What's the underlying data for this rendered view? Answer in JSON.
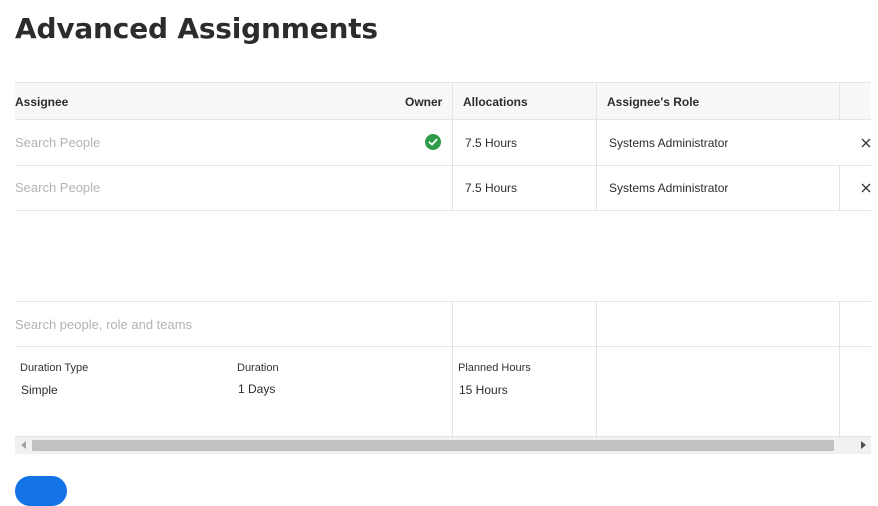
{
  "page": {
    "title": "Advanced Assignments"
  },
  "table": {
    "headers": {
      "assignee": "Assignee",
      "owner": "Owner",
      "allocations": "Allocations",
      "role": "Assignee's Role"
    },
    "rows": [
      {
        "assignee_placeholder": "Search People",
        "owner": true,
        "allocation": "7.5 Hours",
        "role": "Systems Administrator"
      },
      {
        "assignee_placeholder": "Search People",
        "owner": false,
        "allocation": "7.5 Hours",
        "role": "Systems Administrator"
      }
    ],
    "add_search_placeholder": "Search people, role and teams"
  },
  "summary": {
    "duration_type_label": "Duration Type",
    "duration_type_value": "Simple",
    "duration_label": "Duration",
    "duration_value": "1 Days",
    "planned_hours_label": "Planned Hours",
    "planned_hours_value": "15 Hours"
  },
  "icons": {
    "remove": "close-icon",
    "owner": "check-circle-icon"
  },
  "colors": {
    "owner_check": "#2d9d4b",
    "primary": "#1473e6"
  }
}
